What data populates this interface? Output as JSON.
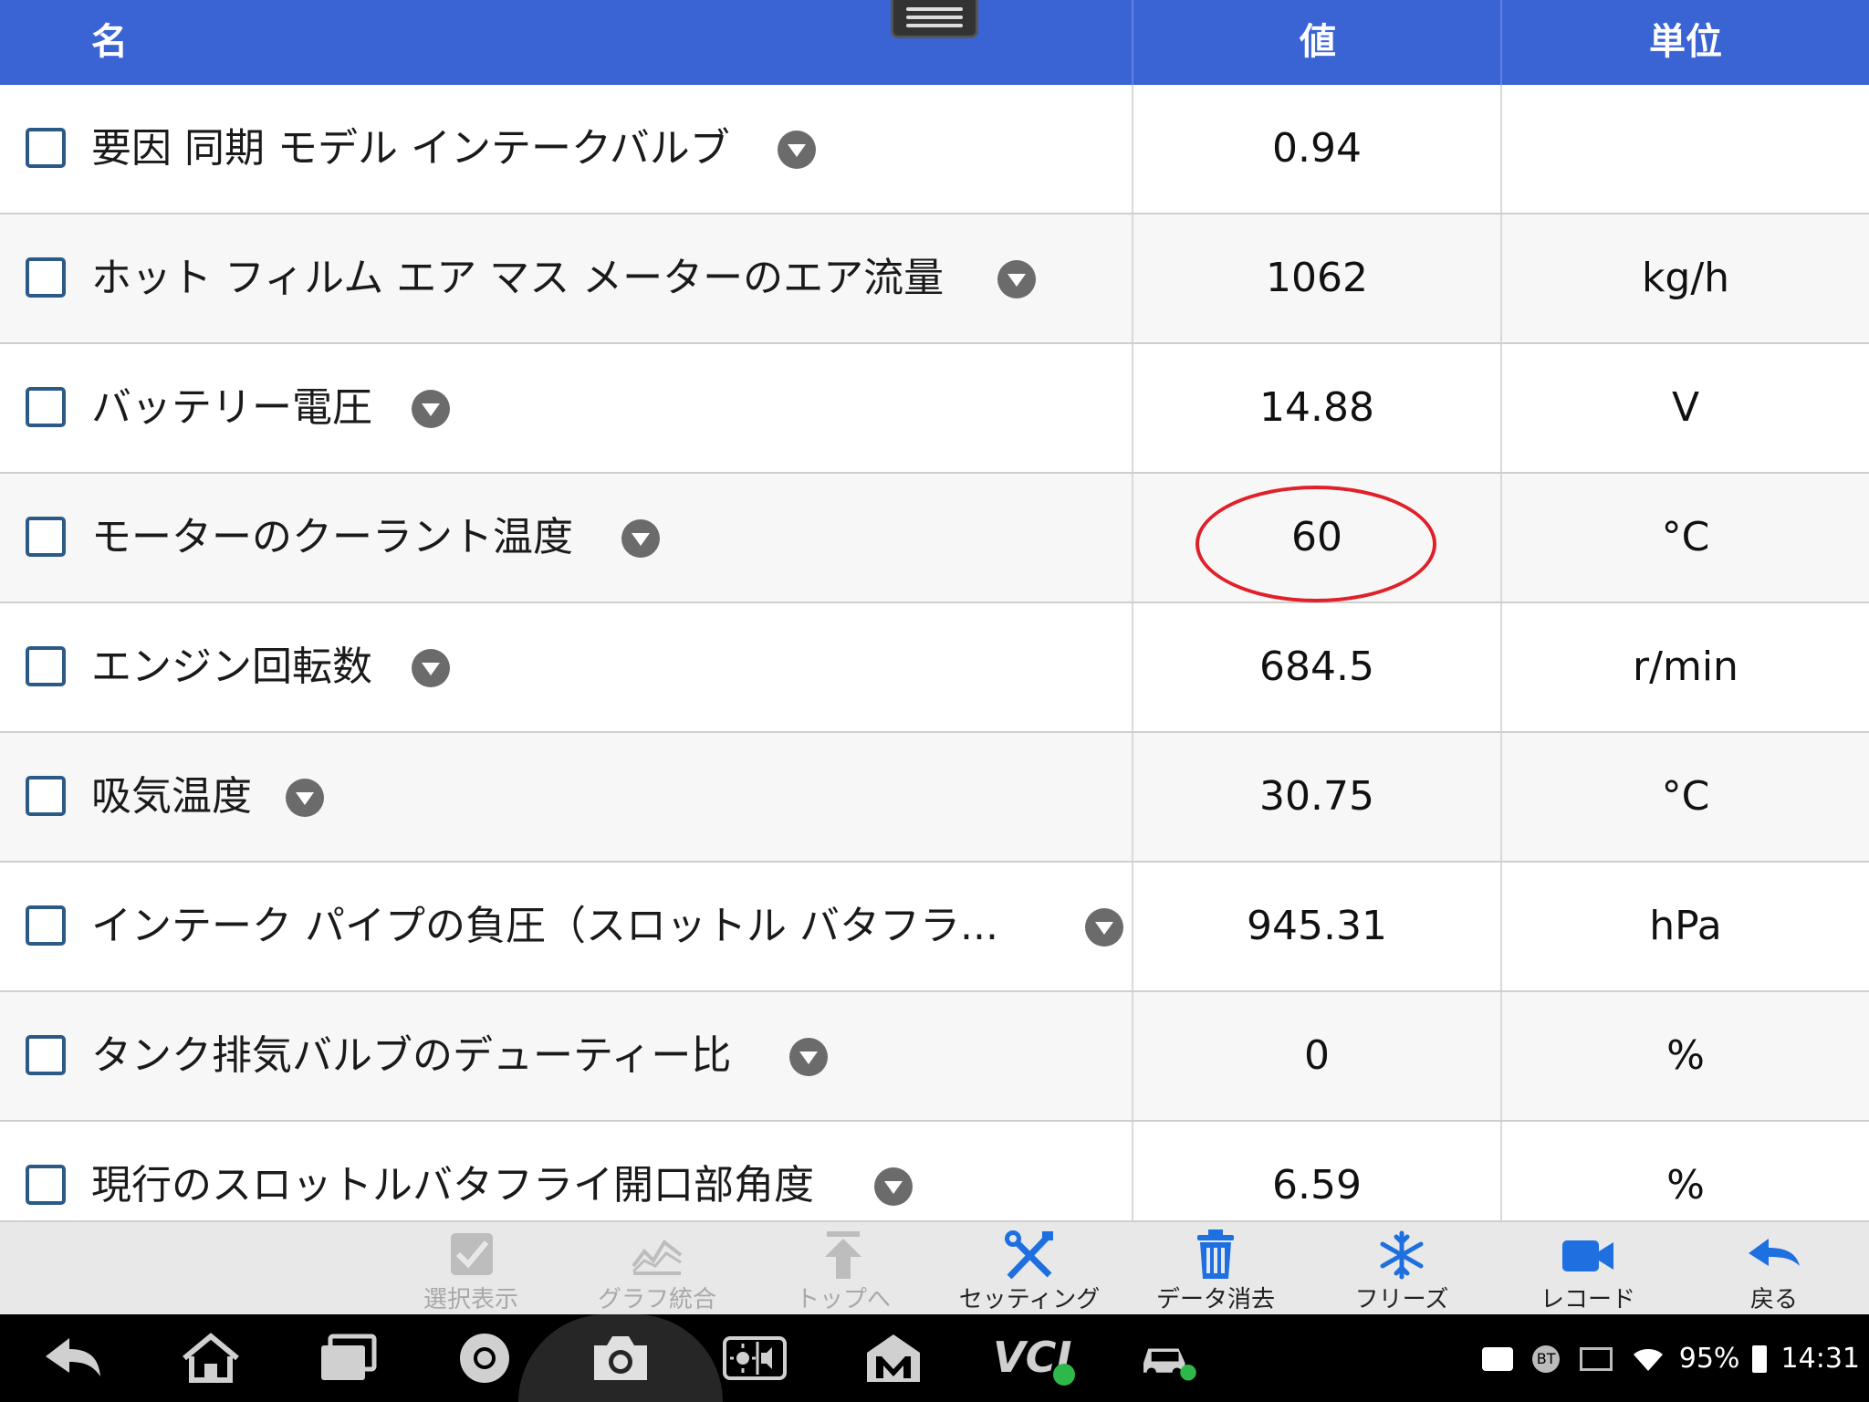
{
  "header": {
    "col_name": "名",
    "col_value": "値",
    "col_unit": "単位"
  },
  "rows": [
    {
      "name": "要因 同期 モデル インテークバルブ",
      "value": "0.94",
      "unit": ""
    },
    {
      "name": "ホット フィルム エア マス メーターのエア流量",
      "value": "1062",
      "unit": "kg/h"
    },
    {
      "name": "バッテリー電圧",
      "value": "14.88",
      "unit": "V"
    },
    {
      "name": "モーターのクーラント温度",
      "value": "60",
      "unit": "°C"
    },
    {
      "name": "エンジン回転数",
      "value": "684.5",
      "unit": "r/min"
    },
    {
      "name": "吸気温度",
      "value": "30.75",
      "unit": "°C"
    },
    {
      "name": "インテーク パイプの負圧（スロットル バタフラ...",
      "value": "945.31",
      "unit": "hPa"
    },
    {
      "name": "タンク排気バルブのデューティー比",
      "value": "0",
      "unit": "%"
    },
    {
      "name": "現行のスロットルバタフライ開口部角度",
      "value": "6.59",
      "unit": "%"
    }
  ],
  "toolbar": {
    "select_view": "選択表示",
    "graph_merge": "グラフ統合",
    "to_top": "トップへ",
    "settings": "セッティング",
    "clear_data": "データ消去",
    "freeze": "フリーズ",
    "record": "レコード",
    "back": "戻る"
  },
  "sysbar": {
    "vci_label": "VCI",
    "bt_label": "BT",
    "battery": "95%",
    "time": "14:31"
  },
  "colors": {
    "header_bg": "#3a64d4",
    "accent_blue": "#1e6fe0",
    "highlight": "#e0202a",
    "ok_green": "#2fb84a"
  }
}
